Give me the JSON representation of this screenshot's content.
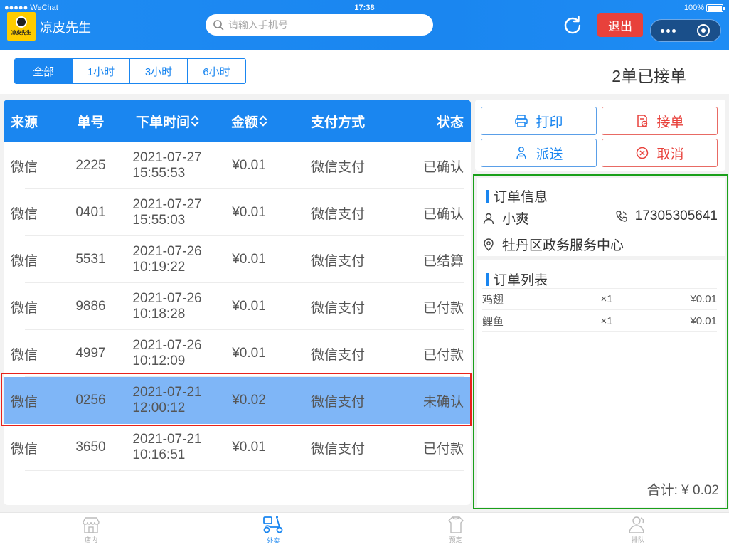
{
  "status_bar": {
    "carrier": "●●●●● WeChat",
    "time": "17:38",
    "battery": "100%",
    "battery_level": 1.0
  },
  "header": {
    "logo_text": "凉皮先生",
    "title": "凉皮先生",
    "search_placeholder": "请输入手机号",
    "search_value": "",
    "logout_label": "退出",
    "icons": {
      "refresh": "refresh-icon",
      "more": "more-dots-icon",
      "close": "close-circle-icon",
      "search": "search-icon"
    }
  },
  "filter": {
    "options": [
      "全部",
      "1小时",
      "3小时",
      "6小时"
    ],
    "selected_index": 0,
    "accepted_summary": "2单已接单"
  },
  "table": {
    "headers": [
      "来源",
      "单号",
      "下单时间",
      "金额",
      "支付方式",
      "状态"
    ],
    "rows": [
      {
        "source": "微信",
        "no": "2225",
        "date": "2021-07-27",
        "time": "15:55:53",
        "amount": "¥0.01",
        "pay": "微信支付",
        "status": "已确认"
      },
      {
        "source": "微信",
        "no": "0401",
        "date": "2021-07-27",
        "time": "15:55:03",
        "amount": "¥0.01",
        "pay": "微信支付",
        "status": "已确认"
      },
      {
        "source": "微信",
        "no": "5531",
        "date": "2021-07-26",
        "time": "10:19:22",
        "amount": "¥0.01",
        "pay": "微信支付",
        "status": "已结算"
      },
      {
        "source": "微信",
        "no": "9886",
        "date": "2021-07-26",
        "time": "10:18:28",
        "amount": "¥0.01",
        "pay": "微信支付",
        "status": "已付款"
      },
      {
        "source": "微信",
        "no": "4997",
        "date": "2021-07-26",
        "time": "10:12:09",
        "amount": "¥0.01",
        "pay": "微信支付",
        "status": "已付款"
      },
      {
        "source": "微信",
        "no": "0256",
        "date": "2021-07-21",
        "time": "12:00:12",
        "amount": "¥0.02",
        "pay": "微信支付",
        "status": "未确认"
      },
      {
        "source": "微信",
        "no": "3650",
        "date": "2021-07-21",
        "time": "10:16:51",
        "amount": "¥0.01",
        "pay": "微信支付",
        "status": "已付款"
      }
    ],
    "selected_index": 5
  },
  "actions": {
    "print": "打印",
    "accept": "接单",
    "deliver": "派送",
    "cancel": "取消"
  },
  "order_info": {
    "title": "订单信息",
    "customer": "小爽",
    "phone": "17305305641",
    "address": "牡丹区政务服务中心"
  },
  "order_list": {
    "title": "订单列表",
    "items": [
      {
        "name": "鸡翅",
        "qty": "×1",
        "price": "¥0.01"
      },
      {
        "name": "鲤鱼",
        "qty": "×1",
        "price": "¥0.01"
      }
    ],
    "total": "合计: ¥ 0.02"
  },
  "tabbar": {
    "tabs": [
      {
        "label": "店内",
        "icon": "store-icon"
      },
      {
        "label": "外卖",
        "icon": "scooter-icon"
      },
      {
        "label": "预定",
        "icon": "reserve-icon"
      },
      {
        "label": "排队",
        "icon": "queue-icon"
      }
    ],
    "active_index": 1
  },
  "colors": {
    "primary": "#1a86f0",
    "danger": "#e8413b",
    "selected_row": "#7fb6f7",
    "highlight_red": "#e8221b",
    "highlight_green": "#1aa01a"
  }
}
